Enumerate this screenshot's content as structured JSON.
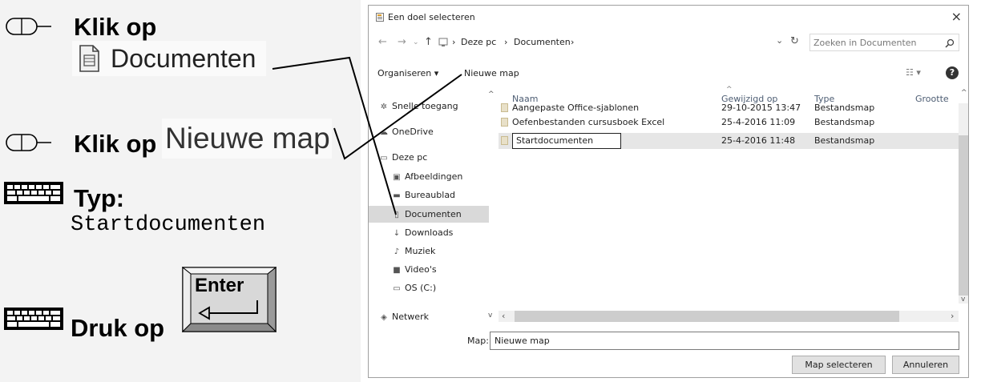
{
  "instructions": {
    "step1": {
      "text": "Klik op",
      "button": "Documenten",
      "icon": "mouse-icon"
    },
    "step2": {
      "text": "Klik op",
      "button": "Nieuwe map",
      "icon": "mouse-icon"
    },
    "step3": {
      "text": "Typ:",
      "typed": "Startdocumenten",
      "icon": "keyboard-icon"
    },
    "step4": {
      "text": "Druk op",
      "key": "Enter",
      "icon": "keyboard-icon"
    }
  },
  "dialog": {
    "title": "Een doel selecteren",
    "close": "×",
    "address": {
      "segments": [
        "Deze pc",
        "Documenten"
      ],
      "separator": "›"
    },
    "search_placeholder": "Zoeken in Documenten",
    "toolbar": {
      "organize": "Organiseren ▾",
      "new_folder": "Nieuwe map"
    },
    "nav_items": [
      "Snelle toegang",
      "OneDrive",
      "Deze pc",
      "Afbeeldingen",
      "Bureaublad",
      "Documenten",
      "Downloads",
      "Muziek",
      "Video's",
      "OS (C:)",
      "Netwerk"
    ],
    "columns": [
      "Naam",
      "Gewijzigd op",
      "Type",
      "Grootte"
    ],
    "rows": [
      {
        "name": "Aangepaste Office-sjablonen",
        "date": "29-10-2015 13:47",
        "type": "Bestandsmap"
      },
      {
        "name": "Oefenbestanden cursusboek Excel",
        "date": "25-4-2016 11:09",
        "type": "Bestandsmap"
      },
      {
        "name": "Startdocumenten",
        "date": "25-4-2016 11:48",
        "type": "Bestandsmap"
      }
    ],
    "map_label": "Map:",
    "map_value": "Nieuwe map",
    "select_button": "Map selecteren",
    "cancel_button": "Annuleren"
  }
}
